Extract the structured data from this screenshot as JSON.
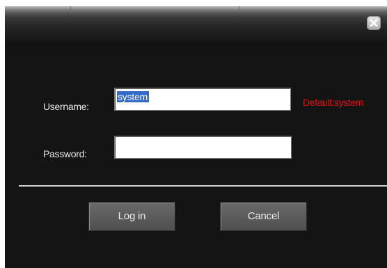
{
  "dialog": {
    "close_icon": "close-icon"
  },
  "form": {
    "username_label": "Username:",
    "username_value": "system",
    "username_hint": "Default:system",
    "password_label": "Password:",
    "password_value": ""
  },
  "buttons": {
    "login_label": "Log in",
    "cancel_label": "Cancel"
  },
  "colors": {
    "dialog_background": "#141414",
    "hint_text": "#e01010",
    "selection": "#3268c8",
    "button_face": "#5c5c5c"
  }
}
